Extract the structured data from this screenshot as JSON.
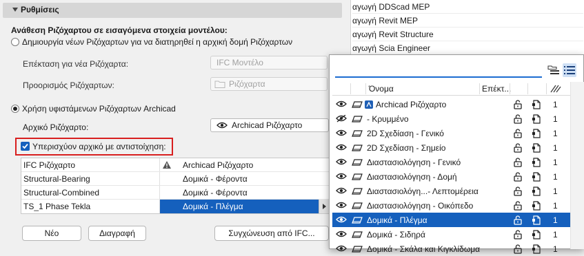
{
  "background_list": {
    "items": [
      "αγωγή DDScad MEP",
      "αγωγή Revit MEP",
      "αγωγή Revit Structure",
      "αγωγή Scia Engineer"
    ]
  },
  "section": {
    "title": "Ρυθμίσεις"
  },
  "mapping": {
    "heading": "Ανάθεση Ριζόχαρτου σε εισαγόμενα στοιχεία μοντέλου:",
    "option_create": "Δημιουργία νέων Ριζόχαρτων για να διατηρηθεί η αρχική δομή Ριζόχαρτων",
    "extension_label": "Επέκταση για νέα Ριζόχαρτα:",
    "extension_value": "IFC Μοντέλο",
    "destination_label": "Προορισμός Ριζόχαρτων:",
    "destination_value": "Ριζόχαρτα",
    "option_use_existing": "Χρήση υφιστάμενων Ριζόχαρτων Archicad",
    "initial_label": "Αρχικό Ριζόχαρτο:",
    "initial_value": "Archicad Ριζόχαρτο",
    "override_checkbox": "Υπερισχύον αρχικό με αντιστοίχηση:",
    "selected_option": "use_existing"
  },
  "map_table": {
    "headers": [
      "IFC Ριζόχαρτο",
      "Archicad Ριζόχαρτο"
    ],
    "rows": [
      {
        "ifc": "Structural-Bearing",
        "archicad": "Δομικά - Φέροντα"
      },
      {
        "ifc": "Structural-Combined",
        "archicad": "Δομικά - Φέροντα"
      },
      {
        "ifc": "TS_1 Phase Tekla",
        "archicad": "Δομικά - Πλέγμα"
      }
    ],
    "selected_row": 2
  },
  "buttons": {
    "new": "Νέο",
    "delete": "Διαγραφή",
    "merge": "Συγχώνευση από IFC..."
  },
  "popup": {
    "search_value": "",
    "columns": {
      "name": "Όνομα",
      "ext": "Επέκτ..."
    },
    "rows": [
      {
        "name": "Archicad Ριζόχαρτο",
        "value": "1",
        "visible": true,
        "archicad_icon": true
      },
      {
        "name": "- Κρυμμένο",
        "value": "1",
        "visible": false
      },
      {
        "name": "2D Σχεδίαση - Γενικό",
        "value": "1",
        "visible": true
      },
      {
        "name": "2D Σχεδίαση - Σημείο",
        "value": "1",
        "visible": true
      },
      {
        "name": "Διαστασιολόγηση - Γενικό",
        "value": "1",
        "visible": true
      },
      {
        "name": "Διαστασιολόγηση - Δομή",
        "value": "1",
        "visible": true
      },
      {
        "name": "Διαστασιολόγη...- Λεπτομέρεια",
        "value": "1",
        "visible": true
      },
      {
        "name": "Διαστασιολόγηση - Οικόπεδο",
        "value": "1",
        "visible": true
      },
      {
        "name": "Δομικά - Πλέγμα",
        "value": "1",
        "visible": true
      },
      {
        "name": "Δομικά - Σιδηρά",
        "value": "1",
        "visible": true
      },
      {
        "name": "Δομικά - Σκάλα και Κιγκλίδωμα",
        "value": "1",
        "visible": true
      }
    ],
    "selected_row": 8
  },
  "colors": {
    "accent": "#1560bd",
    "highlight_border": "#d81e1e"
  }
}
